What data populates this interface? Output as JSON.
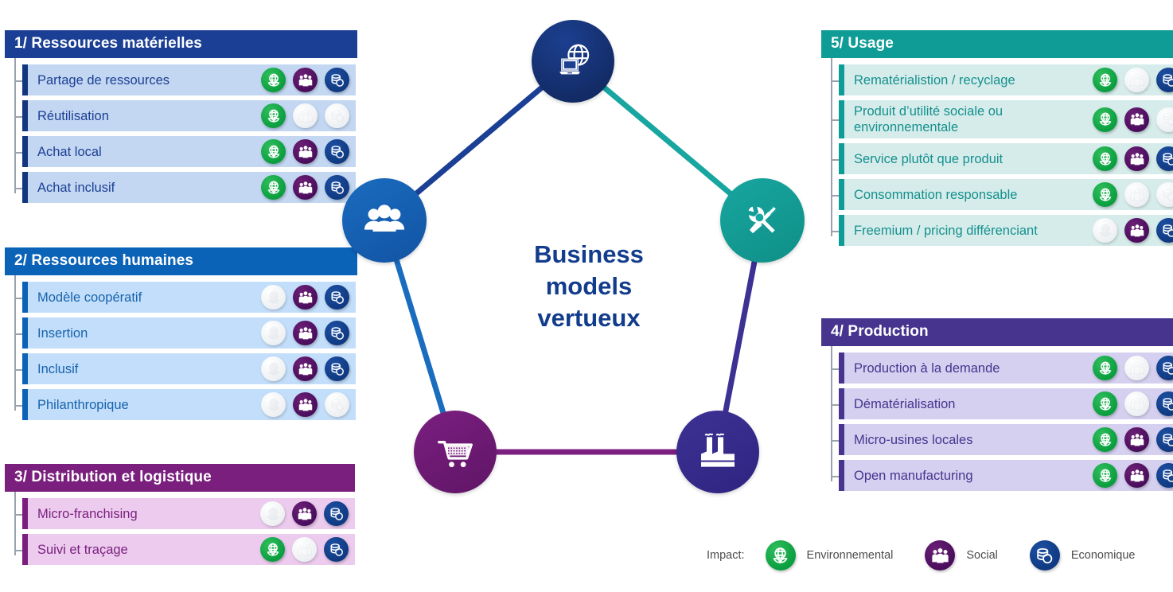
{
  "center": {
    "title_lines": [
      "Business",
      "models",
      "vertueux"
    ],
    "color": "#123c8c"
  },
  "nodes": [
    {
      "id": "top",
      "icon": "globe-laptop-icon",
      "color": "#1c3f8f"
    },
    {
      "id": "left",
      "icon": "people-group-icon",
      "color": "#1a6cbf"
    },
    {
      "id": "right",
      "icon": "tools-icon",
      "color": "#17a6a0"
    },
    {
      "id": "bottom-left",
      "icon": "shopping-cart-icon",
      "color": "#7b1f80"
    },
    {
      "id": "bottom-right",
      "icon": "factory-icon",
      "color": "#3d3194"
    }
  ],
  "sections": [
    {
      "id": "1",
      "header": "1/ Ressources matérielles",
      "header_color": "#1b3f94",
      "row_color": "#c3d7f2",
      "rows": [
        {
          "label": "Partage de ressources",
          "env": true,
          "soc": true,
          "eco": true
        },
        {
          "label": "Réutilisation",
          "env": true,
          "soc": false,
          "eco": false
        },
        {
          "label": "Achat local",
          "env": true,
          "soc": true,
          "eco": true
        },
        {
          "label": "Achat inclusif",
          "env": true,
          "soc": true,
          "eco": true
        }
      ]
    },
    {
      "id": "2",
      "header": "2/ Ressources humaines",
      "header_color": "#0b63b8",
      "row_color": "#c3defa",
      "rows": [
        {
          "label": "Modèle coopératif",
          "env": false,
          "soc": true,
          "eco": true
        },
        {
          "label": "Insertion",
          "env": false,
          "soc": true,
          "eco": true
        },
        {
          "label": "Inclusif",
          "env": false,
          "soc": true,
          "eco": true
        },
        {
          "label": "Philanthropique",
          "env": false,
          "soc": true,
          "eco": false
        }
      ]
    },
    {
      "id": "3",
      "header": "3/ Distribution et logistique",
      "header_color": "#7a1f7e",
      "row_color": "#eccbee",
      "rows": [
        {
          "label": "Micro-franchising",
          "env": false,
          "soc": true,
          "eco": true
        },
        {
          "label": "Suivi et traçage",
          "env": true,
          "soc": false,
          "eco": true
        }
      ]
    },
    {
      "id": "4",
      "header": "4/ Production",
      "header_color": "#46348f",
      "row_color": "#d5d0ef",
      "rows": [
        {
          "label": "Production à la demande",
          "env": true,
          "soc": false,
          "eco": true
        },
        {
          "label": "Dématérialisation",
          "env": true,
          "soc": false,
          "eco": true
        },
        {
          "label": "Micro-usines locales",
          "env": true,
          "soc": true,
          "eco": true
        },
        {
          "label": "Open manufacturing",
          "env": true,
          "soc": true,
          "eco": true
        }
      ]
    },
    {
      "id": "5",
      "header": "5/ Usage",
      "header_color": "#0f9c96",
      "row_color": "#d6eceb",
      "rows": [
        {
          "label": "Rematérialistion / recyclage",
          "env": true,
          "soc": false,
          "eco": true
        },
        {
          "label": "Produit d’utilité sociale ou environnementale",
          "env": true,
          "soc": true,
          "eco": false
        },
        {
          "label": "Service plutôt que produit",
          "env": true,
          "soc": true,
          "eco": true
        },
        {
          "label": "Consommation responsable",
          "env": true,
          "soc": false,
          "eco": false
        },
        {
          "label": "Freemium / pricing différenciant",
          "env": false,
          "soc": true,
          "eco": true
        }
      ]
    }
  ],
  "legend": {
    "title": "Impact:",
    "items": [
      {
        "icon": "environment-globe-icon",
        "label": "Environnemental",
        "color": "#0a9e3f"
      },
      {
        "icon": "social-people-icon",
        "label": "Social",
        "color": "#4a0d5c"
      },
      {
        "icon": "economy-coins-icon",
        "label": "Economique",
        "color": "#103a82"
      }
    ]
  }
}
